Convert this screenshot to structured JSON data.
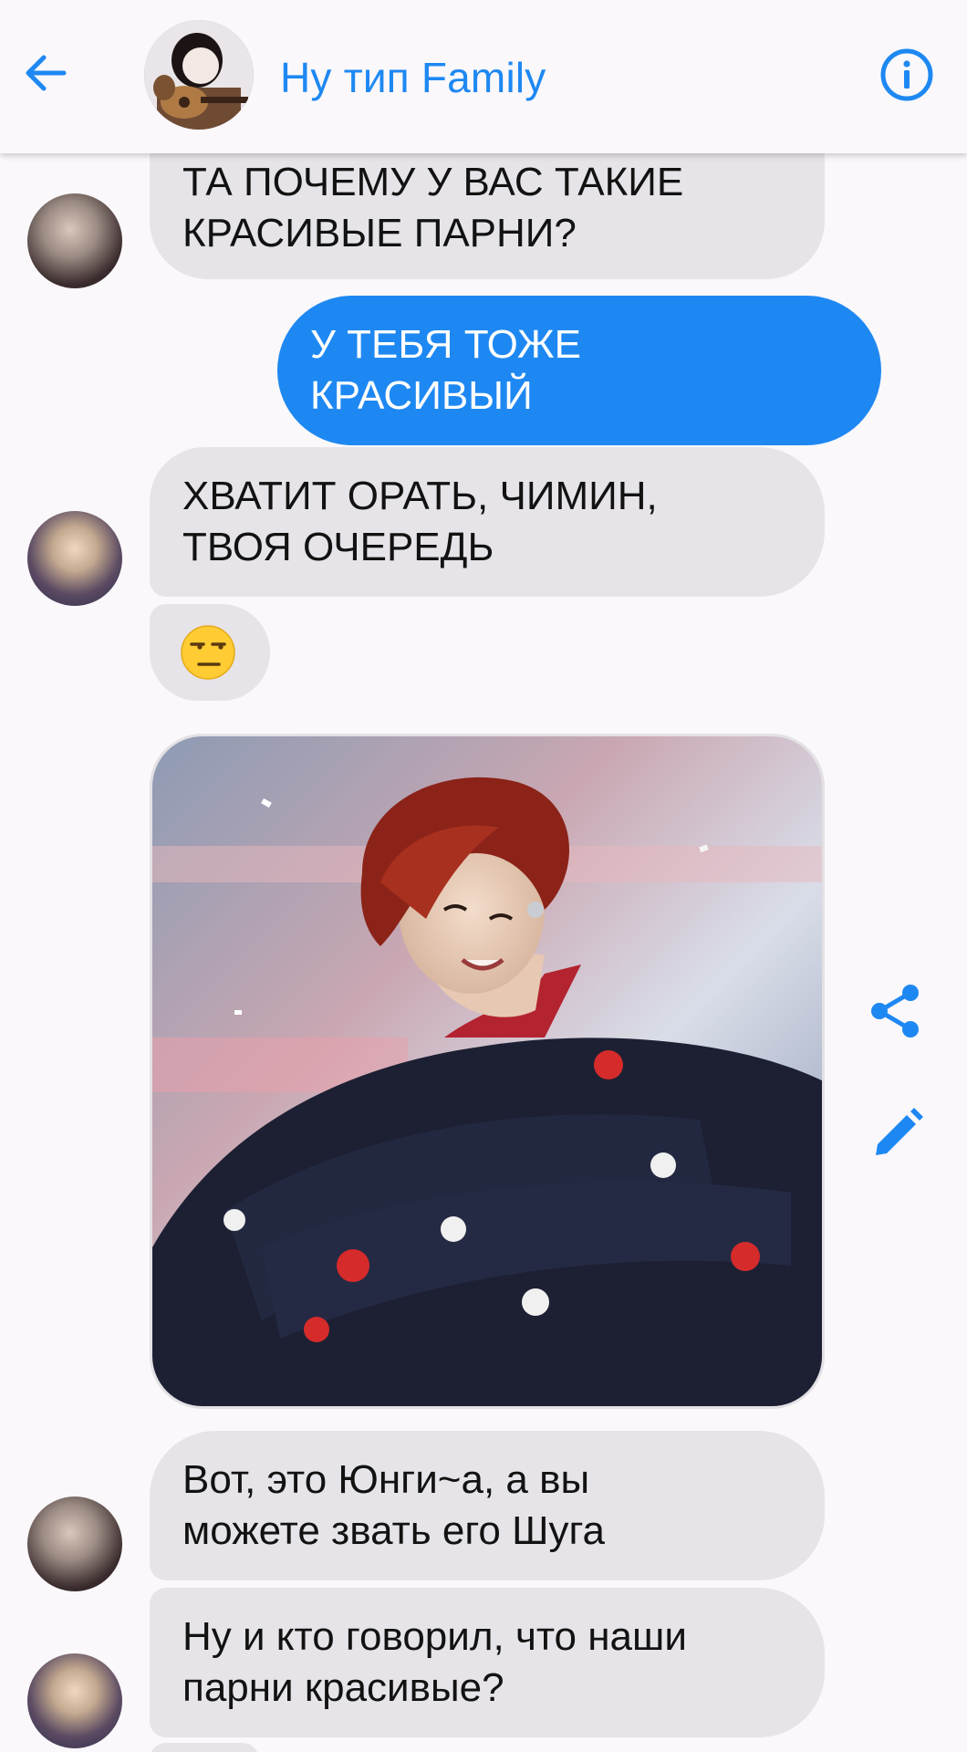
{
  "header": {
    "title": "Ну тип Family",
    "back_icon": "arrow-left-icon",
    "info_icon": "info-icon",
    "accent_color": "#1e88f2"
  },
  "messages": [
    {
      "type": "text",
      "direction": "incoming",
      "lines": [
        "ТА ПОЧЕМУ У ВАС ТАКИЕ",
        "КРАСИВЫЕ ПАРНИ?"
      ]
    },
    {
      "type": "text",
      "direction": "outgoing",
      "lines": [
        "У ТЕБЯ ТОЖЕ",
        "КРАСИВЫЙ"
      ]
    },
    {
      "type": "text",
      "direction": "incoming",
      "lines": [
        "ХВАТИТ ОРАТЬ, ЧИМИН,",
        "ТВОЯ ОЧЕРЕДЬ"
      ]
    },
    {
      "type": "emoji",
      "direction": "incoming",
      "emoji": "unamused-face"
    },
    {
      "type": "photo",
      "direction": "incoming"
    },
    {
      "type": "text",
      "direction": "incoming",
      "lines": [
        "Вот, это Юнги~а, а вы",
        "можете звать его Шуга"
      ]
    },
    {
      "type": "text",
      "direction": "incoming",
      "lines": [
        "Ну и кто говорил, что наши",
        "парни красивые?"
      ]
    }
  ],
  "photo_actions": [
    "share-icon",
    "edit-pencil-icon"
  ],
  "colors": {
    "incoming_bubble": "#e6e4e8",
    "outgoing_bubble": "#1e88f2",
    "background": "#faf8fb"
  }
}
